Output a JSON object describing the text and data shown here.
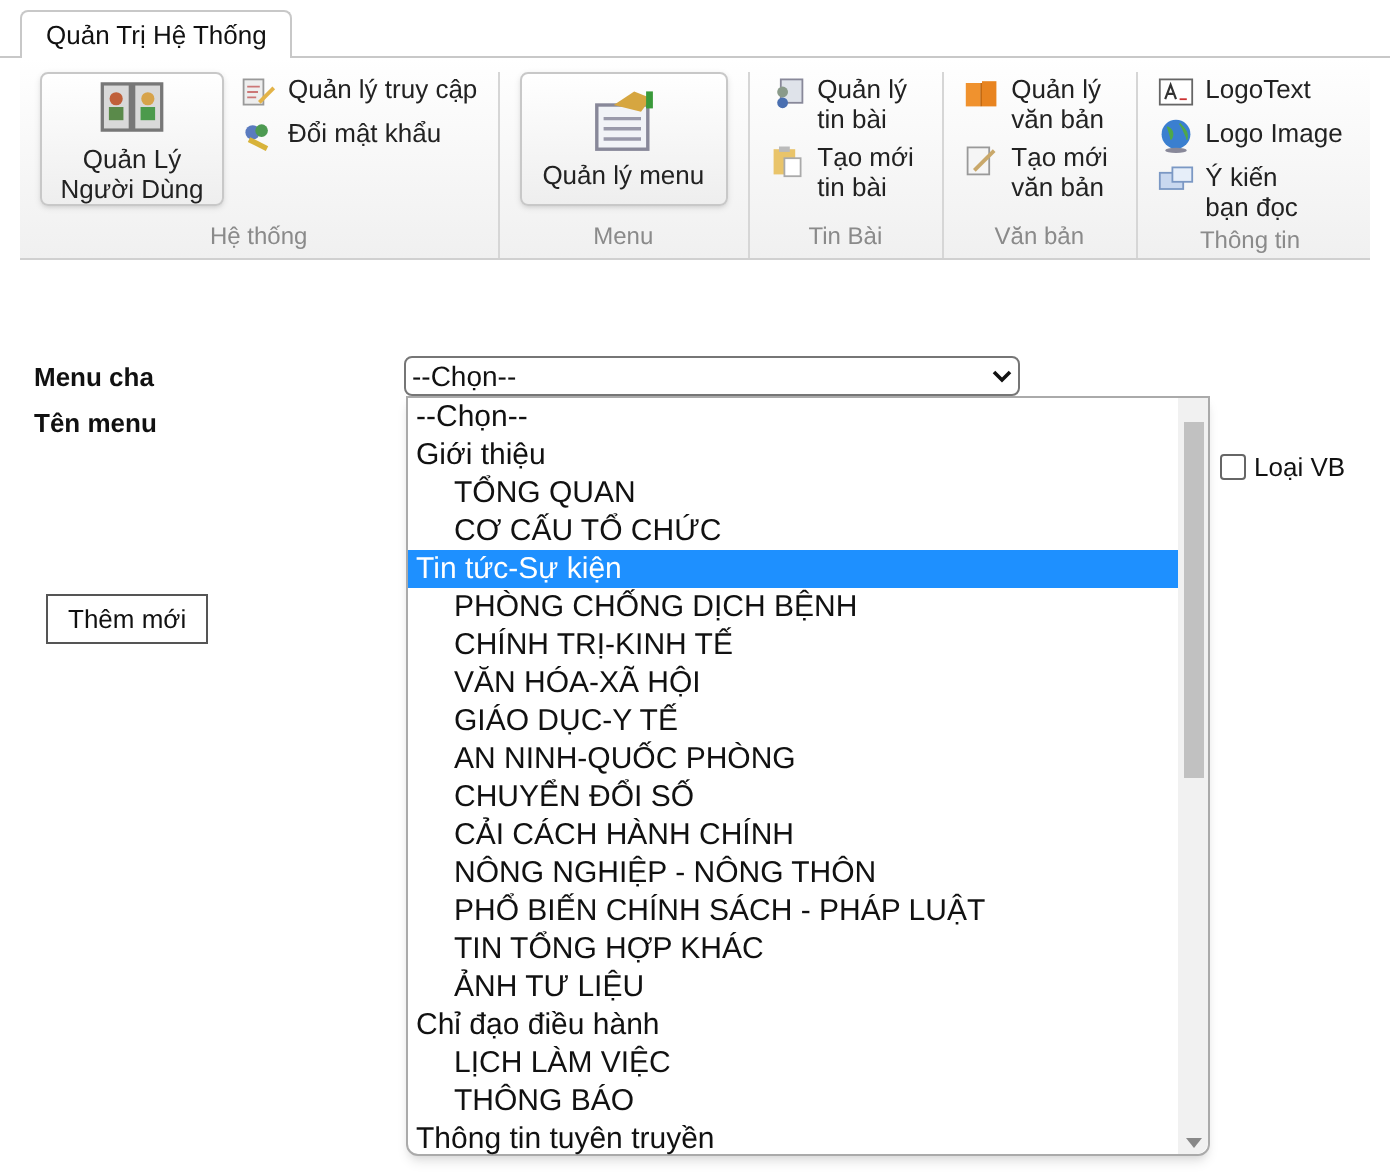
{
  "ribbon": {
    "tabs": [
      {
        "label": "Quản Trị Hệ Thống",
        "selected": true
      }
    ],
    "groups": [
      {
        "label": "Hệ thống",
        "items": [
          {
            "kind": "large",
            "label": "Quản Lý Người Dùng"
          },
          {
            "kind": "small",
            "label": "Quản lý truy cập"
          },
          {
            "kind": "small",
            "label": "Đổi mật khẩu"
          }
        ]
      },
      {
        "label": "Menu",
        "items": [
          {
            "kind": "large",
            "label": "Quản lý menu"
          }
        ]
      },
      {
        "label": "Tin Bài",
        "items": [
          {
            "kind": "wrap",
            "label": "Quản lý tin bài"
          },
          {
            "kind": "wrap",
            "label": "Tạo mới tin bài"
          }
        ]
      },
      {
        "label": "Văn bản",
        "items": [
          {
            "kind": "wrap",
            "label": "Quản lý văn bản"
          },
          {
            "kind": "wrap",
            "label": "Tạo mới văn bản"
          }
        ]
      },
      {
        "label": "Thông tin",
        "items": [
          {
            "kind": "small",
            "label": "LogoText"
          },
          {
            "kind": "small",
            "label": "Logo Image"
          },
          {
            "kind": "wrap",
            "label": "Ý kiến bạn đọc"
          }
        ]
      }
    ]
  },
  "form": {
    "menu_cha_label": "Menu cha",
    "ten_menu_label": "Tên menu",
    "select_value": "--Chọn--",
    "checkbox": {
      "label": "Loại VB",
      "checked": false
    },
    "add_button": "Thêm mới"
  },
  "dropdown": {
    "options": [
      {
        "label": "--Chọn--",
        "selected": false
      },
      {
        "label": "Giới thiệu",
        "selected": false,
        "children": [
          {
            "label": "TỔNG QUAN",
            "selected": false
          },
          {
            "label": "CƠ CẤU TỔ CHỨC",
            "selected": false
          }
        ]
      },
      {
        "label": "Tin tức-Sự kiện",
        "selected": true,
        "children": [
          {
            "label": "PHÒNG CHỐNG DỊCH BỆNH",
            "selected": false
          },
          {
            "label": "CHÍNH TRỊ-KINH TẾ",
            "selected": false
          },
          {
            "label": "VĂN HÓA-XÃ HỘI",
            "selected": false
          },
          {
            "label": "GIÁO DỤC-Y TẾ",
            "selected": false
          },
          {
            "label": "AN NINH-QUỐC PHÒNG",
            "selected": false
          },
          {
            "label": "CHUYỂN ĐỔI SỐ",
            "selected": false
          },
          {
            "label": "CẢI CÁCH HÀNH CHÍNH",
            "selected": false
          },
          {
            "label": "NÔNG NGHIỆP - NÔNG THÔN",
            "selected": false
          },
          {
            "label": "PHỔ BIẾN CHÍNH SÁCH - PHÁP LUẬT",
            "selected": false
          },
          {
            "label": "TIN TỔNG HỢP KHÁC",
            "selected": false
          },
          {
            "label": "ẢNH TƯ LIỆU",
            "selected": false
          }
        ]
      },
      {
        "label": "Chỉ đạo điều hành",
        "selected": false,
        "children": [
          {
            "label": "LỊCH LÀM VIỆC",
            "selected": false
          },
          {
            "label": "THÔNG BÁO",
            "selected": false
          }
        ]
      },
      {
        "label": "Thông tin tuyên truyền",
        "selected": false
      }
    ]
  }
}
